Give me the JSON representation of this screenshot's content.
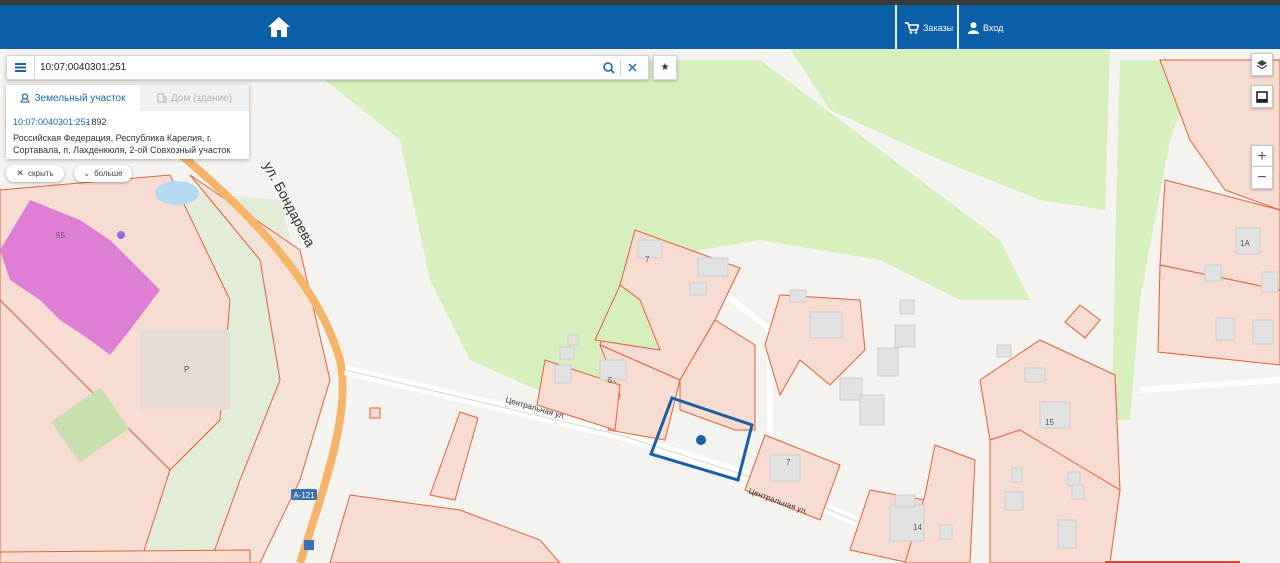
{
  "header": {
    "home_icon": "home-icon",
    "orders_label": "Заказы",
    "login_label": "Вход"
  },
  "search": {
    "value": "10:07:0040301:251"
  },
  "info_card": {
    "tab_land": "Земельный участок",
    "tab_building": "Дом (здание)",
    "parcel_id": "10:07:0040301:251",
    "area": " - 892",
    "address": "Российская Федерация, Республика Карелия, г. Сортавала, п. Лахденкюля, 2-ой Совхозный участок"
  },
  "card_actions": {
    "hide": "скрыть",
    "more": "больше"
  },
  "map_controls": {
    "zoom_in": "+",
    "zoom_out": "−"
  },
  "map": {
    "street_bondareva": "ул. Бондарева",
    "street_central": "Центральная ул.",
    "road_code": "А-121",
    "lot_numbers": [
      "55",
      "P",
      "7",
      "5",
      "7",
      "15",
      "14",
      "1А"
    ],
    "colors": {
      "parcel_fill": "#f7dcd2",
      "parcel_stroke": "#e0603a",
      "forest": "#d7efbf",
      "road": "#f4b469",
      "selected": "#1a5fa3",
      "building_purple": "#d96fd6",
      "header": "#0a5fa8"
    }
  }
}
